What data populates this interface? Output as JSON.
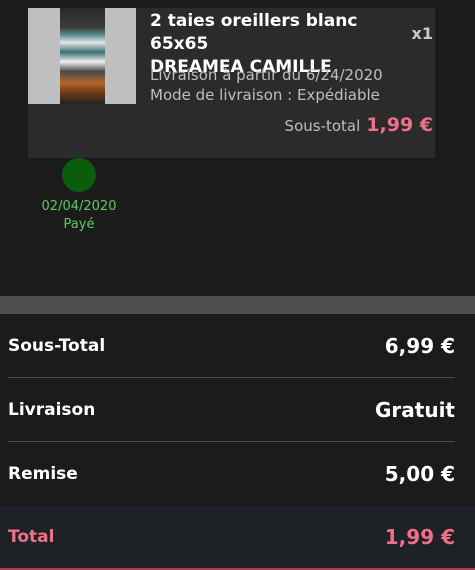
{
  "product": {
    "title_line1": "2 taies oreillers blanc 65x65",
    "title_line2": "DREAMEA CAMILLE",
    "quantity": "x1",
    "delivery_date": "Livraison à partir du 6/24/2020",
    "delivery_mode": "Mode de livraison : Expédiable",
    "subtotal_label": "Sous-total",
    "subtotal_value": "1,99 €"
  },
  "status": {
    "date": "02/04/2020",
    "label": "Payé",
    "color": "#0b5c0b"
  },
  "summary": {
    "rows": [
      {
        "label": "Sous-Total",
        "value": "6,99 €"
      },
      {
        "label": "Livraison",
        "value": "Gratuit"
      },
      {
        "label": "Remise",
        "value": "5,00 €"
      }
    ],
    "total": {
      "label": "Total",
      "value": "1,99 €"
    }
  },
  "colors": {
    "accent": "#f0708a",
    "paid_text": "#5fc95f",
    "background": "#1b1b1b"
  }
}
